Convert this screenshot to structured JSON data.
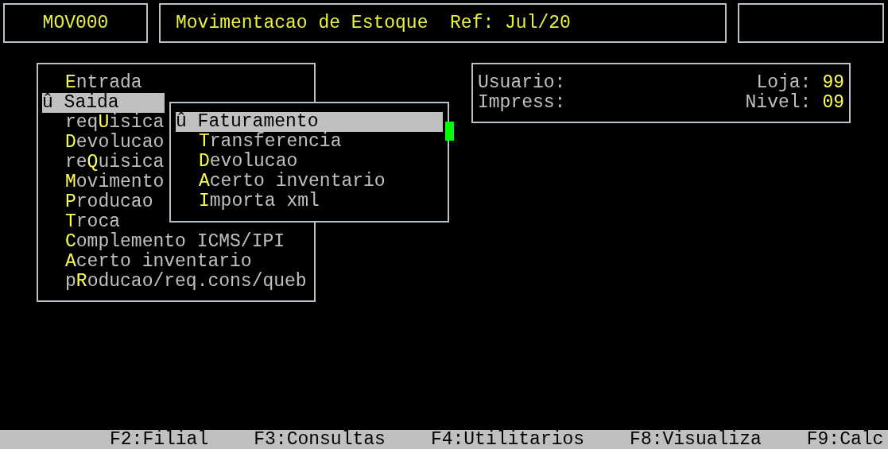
{
  "header": {
    "code": "MOV000",
    "title": "Movimentacao de Estoque  Ref: Jul/20"
  },
  "menu": {
    "items": [
      {
        "label": "**E**ntrada",
        "selected": false
      },
      {
        "label": "Saida",
        "selected": true,
        "marker": "û",
        "children": [
          {
            "label": "Faturamento",
            "selected": true,
            "marker": "û"
          },
          {
            "label": "**T**ransferencia",
            "selected": false
          },
          {
            "label": "**D**evolucao",
            "selected": false
          },
          {
            "label": "**A**certo inventario",
            "selected": false
          },
          {
            "label": "**I**mporta xml",
            "selected": false
          }
        ]
      },
      {
        "label": "req**U**isica",
        "selected": false
      },
      {
        "label": "**D**evolucao",
        "selected": false
      },
      {
        "label": "re**Q**uisica",
        "selected": false
      },
      {
        "label": "**M**ovimento",
        "selected": false
      },
      {
        "label": "**P**roducao",
        "selected": false
      },
      {
        "label": "**T**roca",
        "selected": false
      },
      {
        "label": "**C**omplemento ICMS/IPI",
        "selected": false
      },
      {
        "label": "**A**certo inventario",
        "selected": false
      },
      {
        "label": "p**R**oducao/req.cons/queb",
        "selected": false
      }
    ]
  },
  "info": {
    "rows": [
      {
        "label": "Usuario:",
        "right_label": "Loja:",
        "right_value": "99"
      },
      {
        "label": "Impress:",
        "right_label": "Nivel:",
        "right_value": "09"
      }
    ]
  },
  "footer": {
    "keys": [
      "F2:Filial",
      "F3:Consultas",
      "F4:Utilitarios",
      "F8:Visualiza",
      "F9:Calc"
    ]
  }
}
